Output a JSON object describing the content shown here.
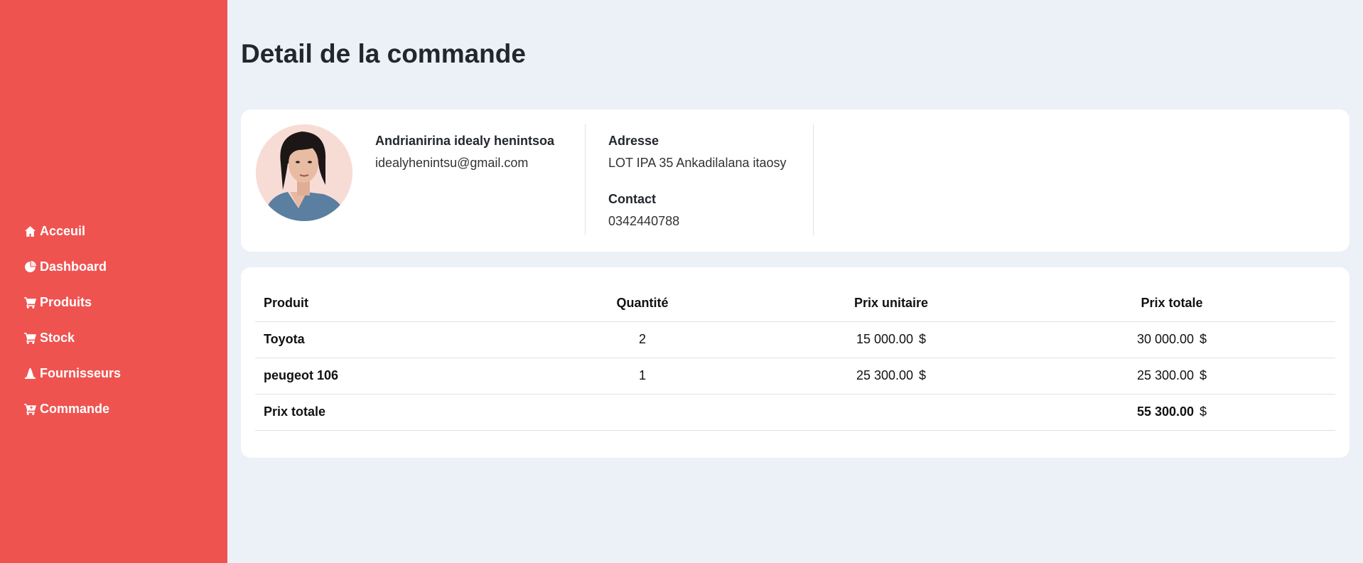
{
  "page": {
    "title": "Detail de la commande"
  },
  "sidebar": {
    "items": [
      {
        "label": "Acceuil",
        "icon": "home-icon"
      },
      {
        "label": "Dashboard",
        "icon": "pie-chart-icon"
      },
      {
        "label": "Produits",
        "icon": "cart-icon"
      },
      {
        "label": "Stock",
        "icon": "cart-icon"
      },
      {
        "label": "Fournisseurs",
        "icon": "cone-icon"
      },
      {
        "label": "Commande",
        "icon": "cart-plus-icon"
      }
    ]
  },
  "client": {
    "name": "Andrianirina idealy henintsoa",
    "email": "idealyhenintsu@gmail.com",
    "address_label": "Adresse",
    "address": "LOT IPA 35 Ankadilalana itaosy",
    "contact_label": "Contact",
    "contact": "0342440788"
  },
  "order": {
    "headers": [
      "Produit",
      "Quantité",
      "Prix unitaire",
      "Prix totale"
    ],
    "rows": [
      {
        "product": "Toyota",
        "qty": "2",
        "unit_price": "15 000.00",
        "total": "30 000.00"
      },
      {
        "product": "peugeot 106",
        "qty": "1",
        "unit_price": "25 300.00",
        "total": "25 300.00"
      }
    ],
    "total_label": "Prix totale",
    "grand_total": "55 300.00",
    "currency": "$"
  },
  "colors": {
    "sidebar": "#ef5350",
    "background": "#ecf0f7",
    "card": "#ffffff"
  }
}
